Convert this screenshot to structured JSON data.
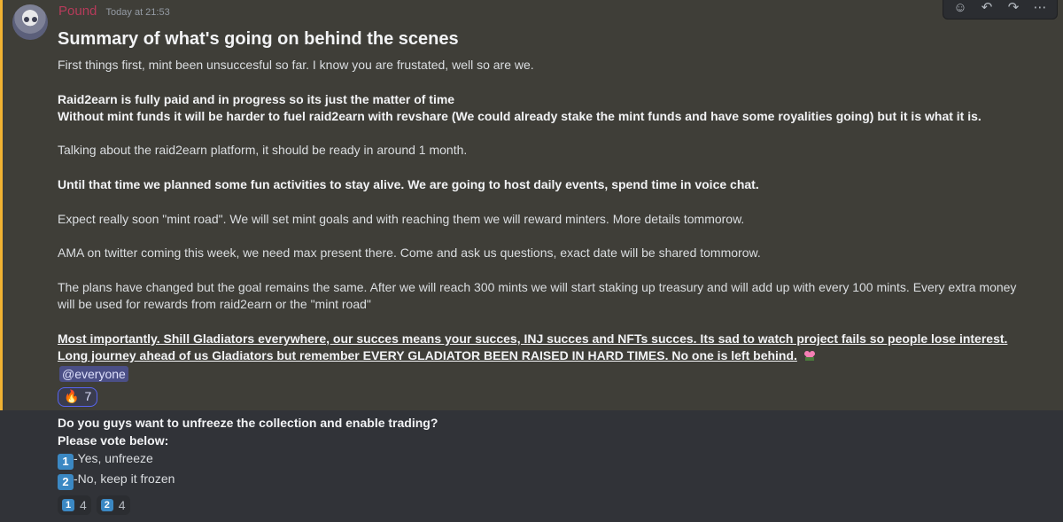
{
  "message": {
    "author": "Pound",
    "timestamp": "Today at 21:53",
    "title": "Summary of what's going on behind the scenes",
    "lines": {
      "l1": "First things first, mint been unsuccesful so far. I know you are frustated, well so are we.",
      "l2": "Raid2earn is fully paid and in progress so its just the matter of time",
      "l3": "Without mint funds it will be harder to fuel raid2earn with revshare (We could already stake the mint funds and have some royalities going) but it is what it is.",
      "l4": "Talking about the raid2earn platform, it should be ready in around 1 month.",
      "l5": "Until that time we planned some fun activities to stay alive. We are going to host daily events, spend time in voice chat.",
      "l6": "Expect really soon \"mint road\". We will set mint goals and with reaching them we will reward minters. More details tommorow.",
      "l7": "AMA on twitter coming this week, we need max present there. Come and ask us questions, exact date will be shared tommorow.",
      "l8": "The plans have changed but the goal remains the same. After we will reach 300 mints we will start staking up treasury and will add up with every 100 mints. Every extra money will be used for rewards from raid2earn or the \"mint road\"",
      "l9": "Most importantly. Shill Gladiators everywhere, our succes means your succes, INJ succes and NFTs succes. Its sad to watch project fails so people lose interest. Long journey ahead of us Gladiators but remember EVERY GLADIATOR BEEN RAISED IN HARD TIMES. No one is left behind."
    },
    "mention": "@everyone",
    "reaction": {
      "emoji": "🔥",
      "count": "7"
    }
  },
  "poll": {
    "question": "Do you guys want to unfreeze the collection and enable trading?",
    "prompt": "Please vote below:",
    "options": [
      {
        "key": "1",
        "label": "-Yes, unfreeze"
      },
      {
        "key": "2",
        "label": "-No, keep it frozen"
      }
    ],
    "reactions": [
      {
        "key": "1",
        "count": "4"
      },
      {
        "key": "2",
        "count": "4"
      }
    ]
  },
  "toolbar": {
    "icons": [
      "add-reaction-icon",
      "reply-icon",
      "forward-icon",
      "more-icon"
    ]
  },
  "colors": {
    "highlight_bar": "#f0b232",
    "author": "#b63b5a",
    "keycap": "#3b88c3",
    "mention_bg": "#4b4f86"
  }
}
